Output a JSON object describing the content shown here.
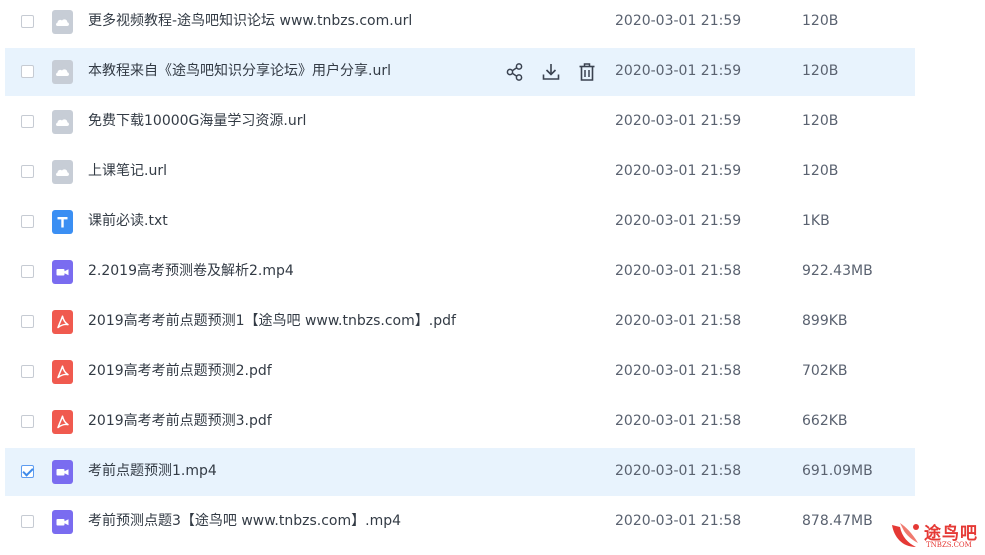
{
  "files": [
    {
      "name": "更多视频教程-途鸟吧知识论坛 www.tnbzs.com.url",
      "date": "2020-03-01 21:59",
      "size": "120B",
      "type": "url",
      "checked": false,
      "highlighted": false
    },
    {
      "name": "本教程来自《途鸟吧知识分享论坛》用户分享.url",
      "date": "2020-03-01 21:59",
      "size": "120B",
      "type": "url",
      "checked": false,
      "highlighted": true
    },
    {
      "name": "免费下载10000G海量学习资源.url",
      "date": "2020-03-01 21:59",
      "size": "120B",
      "type": "url",
      "checked": false,
      "highlighted": false
    },
    {
      "name": "上课笔记.url",
      "date": "2020-03-01 21:59",
      "size": "120B",
      "type": "url",
      "checked": false,
      "highlighted": false
    },
    {
      "name": "课前必读.txt",
      "date": "2020-03-01 21:59",
      "size": "1KB",
      "type": "txt",
      "checked": false,
      "highlighted": false
    },
    {
      "name": "2.2019高考预测卷及解析2.mp4",
      "date": "2020-03-01 21:58",
      "size": "922.43MB",
      "type": "video",
      "checked": false,
      "highlighted": false
    },
    {
      "name": "2019高考考前点题预测1【途鸟吧 www.tnbzs.com】.pdf",
      "date": "2020-03-01 21:58",
      "size": "899KB",
      "type": "pdf",
      "checked": false,
      "highlighted": false
    },
    {
      "name": "2019高考考前点题预测2.pdf",
      "date": "2020-03-01 21:58",
      "size": "702KB",
      "type": "pdf",
      "checked": false,
      "highlighted": false
    },
    {
      "name": "2019高考考前点题预测3.pdf",
      "date": "2020-03-01 21:58",
      "size": "662KB",
      "type": "pdf",
      "checked": false,
      "highlighted": false
    },
    {
      "name": "考前点题预测1.mp4",
      "date": "2020-03-01 21:58",
      "size": "691.09MB",
      "type": "video",
      "checked": true,
      "highlighted": true
    },
    {
      "name": "考前预测点题3【途鸟吧 www.tnbzs.com】.mp4",
      "date": "2020-03-01 21:58",
      "size": "878.47MB",
      "type": "video",
      "checked": false,
      "highlighted": false
    }
  ],
  "row_actions": {
    "row_index": 1,
    "icons": [
      "share-icon",
      "download-icon",
      "delete-icon"
    ]
  },
  "icon_colors": {
    "url": "#c7cdd6",
    "txt": "#3b8ff3",
    "video": "#7a6cf0",
    "pdf": "#f05a4f"
  },
  "accent_colors": {
    "row_highlight": "#e8f3fd",
    "checkbox_check": "#3f8be9",
    "watermark": "#e53935"
  },
  "watermark": {
    "title": "途鸟吧",
    "subtitle": "TNBZS.COM"
  }
}
